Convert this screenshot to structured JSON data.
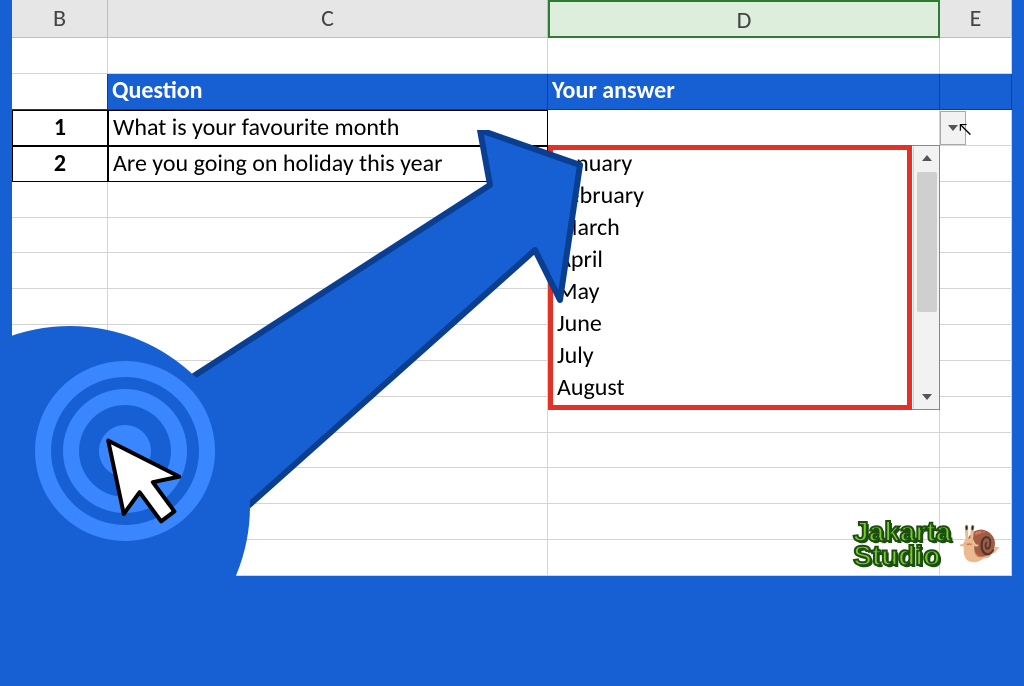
{
  "columns": {
    "B": "B",
    "C": "C",
    "D": "D",
    "E": "E"
  },
  "headers": {
    "question": "Question",
    "answer": "Your answer"
  },
  "rows": [
    {
      "n": "1",
      "q": "What is your favourite month"
    },
    {
      "n": "2",
      "q": "Are you going on holiday this year"
    }
  ],
  "dropdown": {
    "options": [
      "January",
      "February",
      "March",
      "April",
      "May",
      "June",
      "July",
      "August"
    ]
  },
  "branding": {
    "name": "Jakarta\nStudio",
    "snail": "🐌"
  }
}
